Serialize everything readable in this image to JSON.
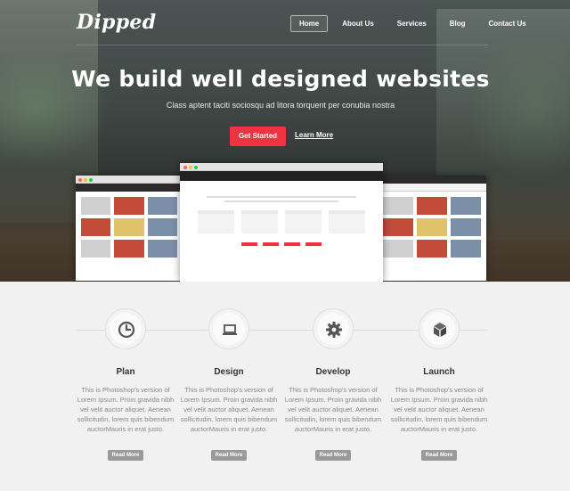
{
  "brand": {
    "logo": "Dipped"
  },
  "nav": {
    "items": [
      {
        "label": "Home",
        "active": true
      },
      {
        "label": "About Us"
      },
      {
        "label": "Services"
      },
      {
        "label": "Blog"
      },
      {
        "label": "Contact Us"
      }
    ]
  },
  "hero": {
    "title": "We build well designed websites",
    "subtitle": "Class aptent taciti sociosqu ad litora torquent per conubia nostra",
    "primary_button": "Get Started",
    "secondary_link": "Learn More",
    "accent_color": "#ef3340"
  },
  "features": [
    {
      "icon": "clock-icon",
      "title": "Plan",
      "text": "This is Photoshop's version of Lorem Ipsum. Proin gravida nibh vel velit auctor aliquet. Aenean sollicitudin, lorem quis bibendum auctorMauris in erat justo.",
      "button": "Read More"
    },
    {
      "icon": "laptop-icon",
      "title": "Design",
      "text": "This is Photoshop's version of Lorem Ipsum. Proin gravida nibh vel velit auctor aliquet. Aenean sollicitudin, lorem quis bibendum auctorMauris in erat justo.",
      "button": "Read More"
    },
    {
      "icon": "gear-icon",
      "title": "Develop",
      "text": "This is Photoshop's version of Lorem Ipsum. Proin gravida nibh vel velit auctor aliquet. Aenean sollicitudin, lorem quis bibendum auctorMauris in erat justo.",
      "button": "Read More"
    },
    {
      "icon": "box-icon",
      "title": "Launch",
      "text": "This is Photoshop's version of Lorem Ipsum. Proin gravida nibh vel velit auctor aliquet. Aenean sollicitudin, lorem quis bibendum auctorMauris in erat justo.",
      "button": "Read More"
    }
  ]
}
